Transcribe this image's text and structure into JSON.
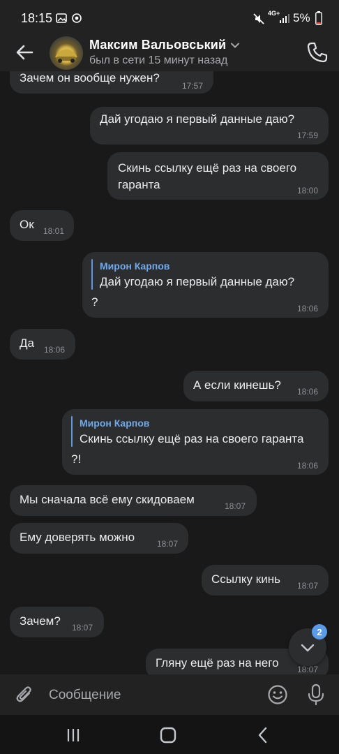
{
  "status_bar": {
    "time": "18:15",
    "network": "4G+",
    "battery": "5%"
  },
  "header": {
    "contact_name": "Максим Вальовський",
    "last_seen": "был в сети 15 минут назад"
  },
  "messages": [
    {
      "text": "Зачем он вообще нужен?",
      "time": "17:57"
    },
    {
      "text": "Дай угодаю я первый данные даю?",
      "time": "17:59"
    },
    {
      "text_lines": [
        "Скинь ссылку ещё раз на своего",
        "гаранта"
      ],
      "time": "18:00"
    },
    {
      "text": "Ок",
      "time": "18:01"
    },
    {
      "reply_author": "Мирон Карпов",
      "reply_text": "Дай угодаю я первый данные даю?",
      "text": "?",
      "time": "18:06"
    },
    {
      "text": "Да",
      "time": "18:06"
    },
    {
      "text": "А если кинешь?",
      "time": "18:06"
    },
    {
      "reply_author": "Мирон Карпов",
      "reply_text": "Скинь ссылку ещё раз на своего гаранта",
      "text": "?!",
      "time": "18:06"
    },
    {
      "text": "Мы сначала всё ему скидоваем",
      "time": "18:07"
    },
    {
      "text": "Ему доверять можно",
      "time": "18:07"
    },
    {
      "text": "Ссылку кинь",
      "time": "18:07"
    },
    {
      "text": "Зачем?",
      "time": "18:07"
    },
    {
      "text": "Гляну ещё раз на него",
      "time": "18:07"
    }
  ],
  "scroll_button": {
    "unread_count": "2"
  },
  "composer": {
    "placeholder": "Сообщение"
  },
  "colors": {
    "background": "#19191a",
    "bubble": "#2c2d2e",
    "accent": "#5e97e8"
  }
}
